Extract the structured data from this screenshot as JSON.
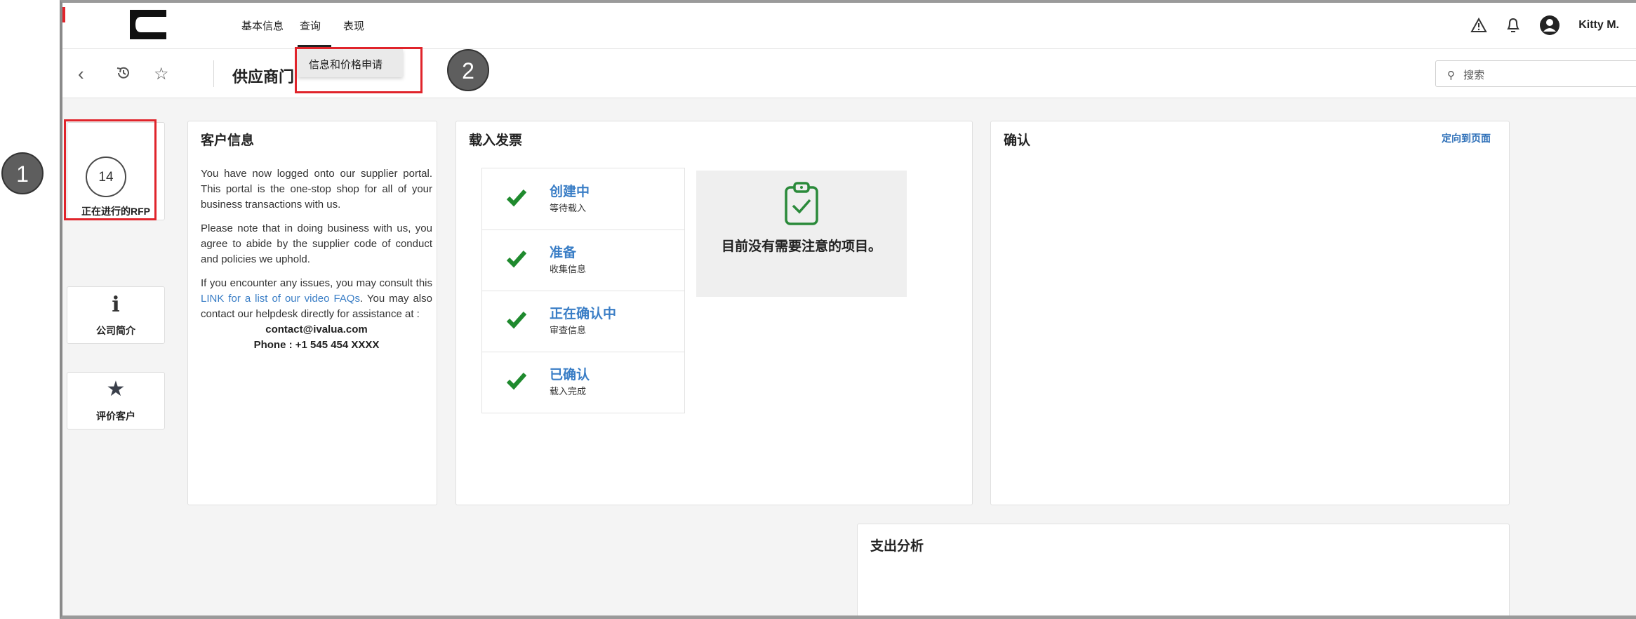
{
  "brand": {
    "logo_text": "Cummins",
    "accent_color": "#e0242b",
    "link_color": "#3a7ec6"
  },
  "nav": {
    "items": [
      "基本信息",
      "查询",
      "表现"
    ],
    "active_index": 1
  },
  "header_icons": {
    "alert": "warning-icon",
    "bell": "bell-icon",
    "avatar": "user-avatar-icon"
  },
  "user": {
    "name": "Kitty M."
  },
  "subbar": {
    "title": "供应商门",
    "search_placeholder": "搜索",
    "icons": [
      "back-icon",
      "history-icon",
      "star-outline-icon"
    ]
  },
  "dropdown": {
    "item": "信息和价格申请"
  },
  "sidebar": {
    "rfp": {
      "count": "14",
      "label": "正在进行的RFP"
    },
    "company": {
      "icon_char": "i",
      "label": "公司简介"
    },
    "rate": {
      "icon_char": "★",
      "label": "评价客户"
    }
  },
  "customer_info": {
    "title": "客户信息",
    "p1": "You have now logged onto our supplier portal. This portal is the one-stop shop for all of your business transactions with us.",
    "p2": "Please note that in doing business with us, you agree to abide by the supplier code of conduct and policies we uphold.",
    "p3_before": "If you encounter any issues, you may consult this ",
    "p3_link": "LINK for a list of our video FAQs",
    "p3_after": ". You may also contact our helpdesk directly for assistance at :",
    "email": "contact@ivalua.com",
    "phone": "Phone : +1 545 454 XXXX"
  },
  "invoice": {
    "title": "载入发票",
    "steps": [
      {
        "name": "创建中",
        "sub": "等待载入"
      },
      {
        "name": "准备",
        "sub": "收集信息"
      },
      {
        "name": "正在确认中",
        "sub": "审查信息"
      },
      {
        "name": "已确认",
        "sub": "载入完成"
      }
    ],
    "notice": "目前没有需要注意的项目。"
  },
  "confirm": {
    "title": "确认",
    "link": "定向到页面"
  },
  "spend": {
    "title": "支出分析"
  },
  "callouts": [
    "1",
    "2"
  ]
}
